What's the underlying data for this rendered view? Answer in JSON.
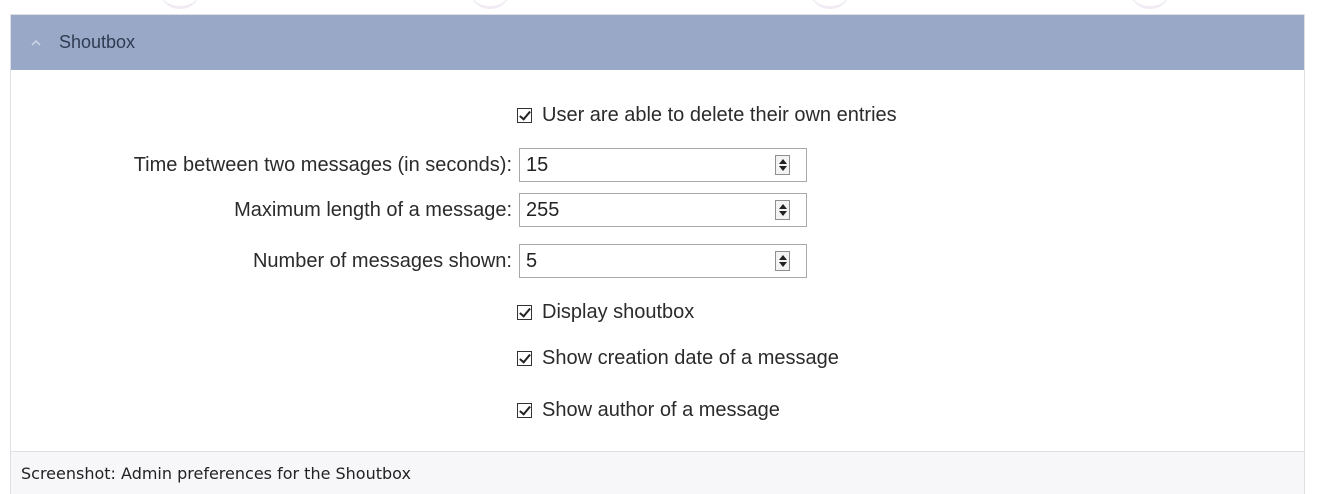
{
  "panel": {
    "title": "Shoutbox",
    "collapse_icon": "chevron-up-icon",
    "header_color": "#98a8c6"
  },
  "settings": {
    "delete_own": {
      "label": "User are able to delete their own entries",
      "checked": true
    },
    "time_between": {
      "label": "Time between two messages (in seconds):",
      "value": "15"
    },
    "max_length": {
      "label": "Maximum length of a message:",
      "value": "255"
    },
    "num_shown": {
      "label": "Number of messages shown:",
      "value": "5"
    },
    "display_shoutbox": {
      "label": "Display shoutbox",
      "checked": true
    },
    "show_date": {
      "label": "Show creation date of a message",
      "checked": true
    },
    "show_author": {
      "label": "Show author of a message",
      "checked": true
    }
  },
  "caption": "Screenshot: Admin preferences for the Shoutbox"
}
